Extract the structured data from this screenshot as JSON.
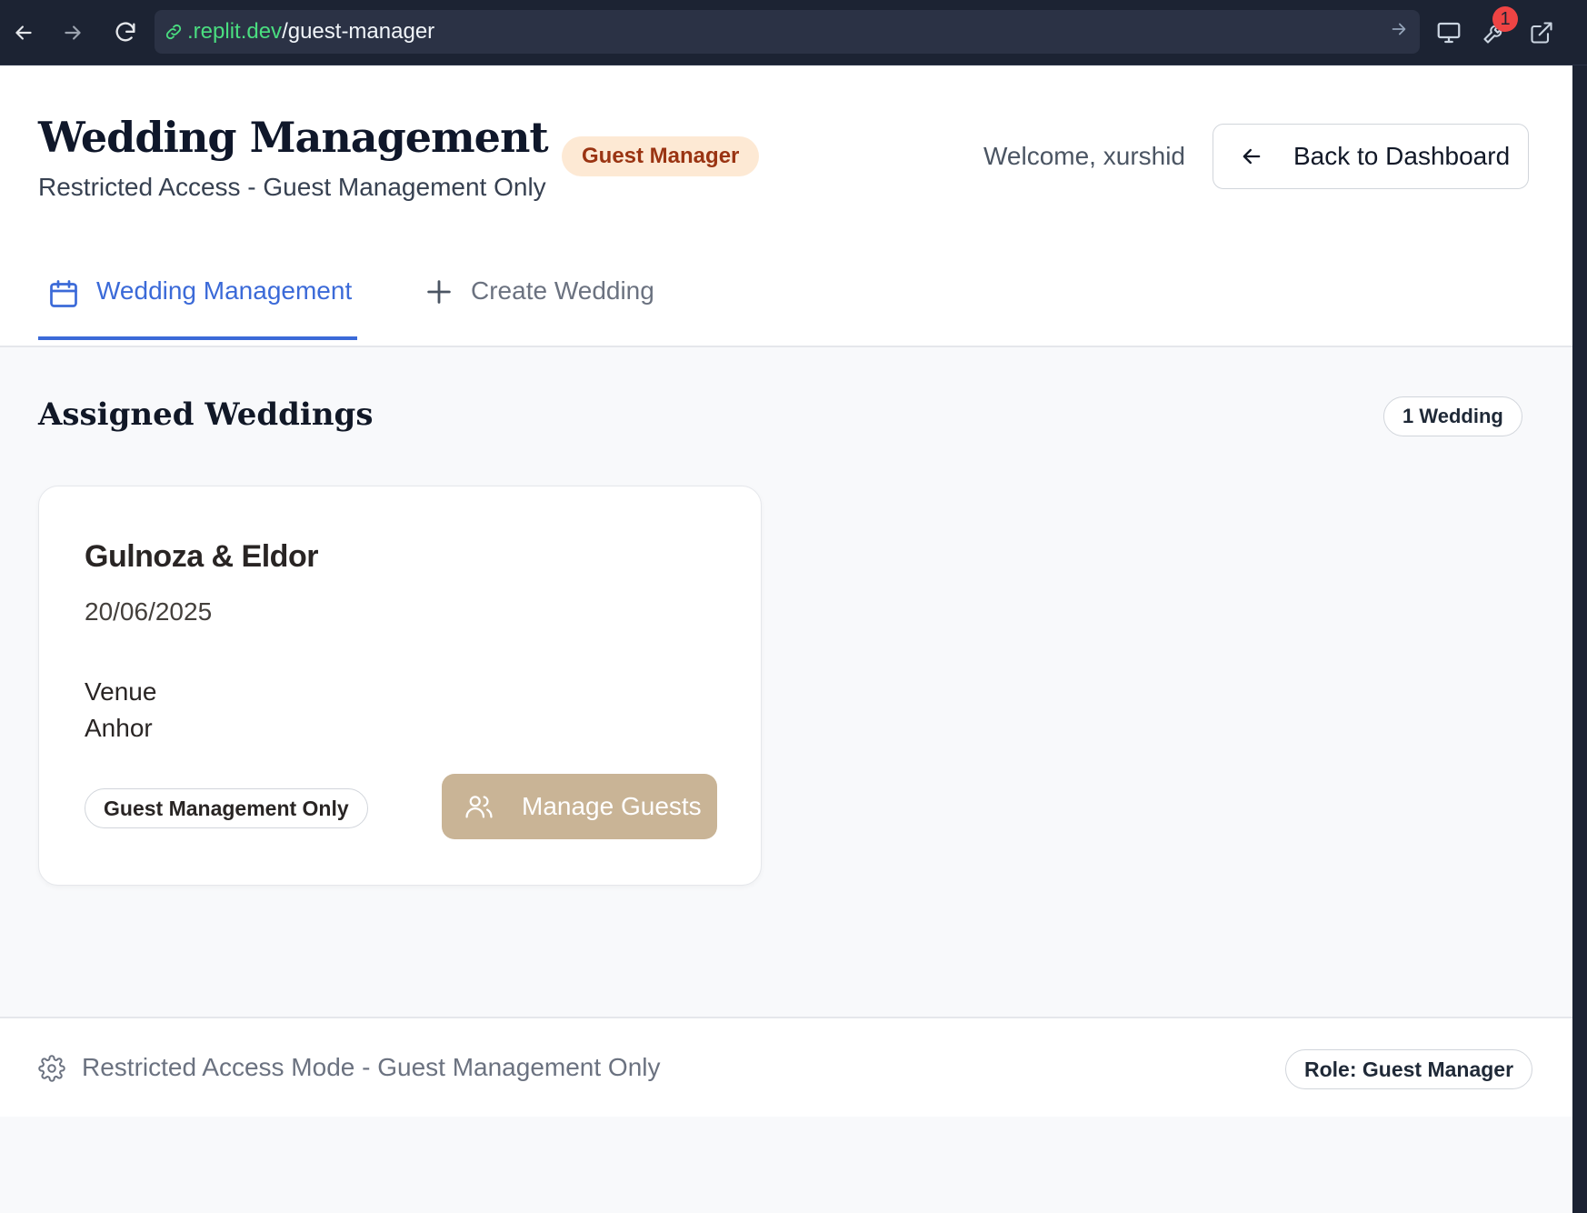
{
  "browser": {
    "url_host": ".replit.dev",
    "url_path": "/guest-manager",
    "notification_count": "1"
  },
  "header": {
    "title": "Wedding Management",
    "subtitle": "Restricted Access - Guest Management Only",
    "role_badge": "Guest Manager",
    "welcome": "Welcome, xurshid",
    "back_button": "Back to Dashboard"
  },
  "tabs": [
    {
      "label": "Wedding Management",
      "icon": "calendar-icon",
      "active": true
    },
    {
      "label": "Create Wedding",
      "icon": "plus-icon",
      "active": false
    }
  ],
  "main": {
    "section_title": "Assigned Weddings",
    "count_badge": "1 Wedding",
    "weddings": [
      {
        "couple": "Gulnoza & Eldor",
        "date": "20/06/2025",
        "venue_label": "Venue",
        "venue": "Anhor",
        "access_badge": "Guest Management Only",
        "action_label": "Manage Guests"
      }
    ]
  },
  "footer": {
    "text": "Restricted Access Mode - Guest Management Only",
    "role_badge": "Role: Guest Manager"
  },
  "colors": {
    "accent": "#3b6ad8",
    "manage_button": "#c9b496",
    "role_chip_bg": "#fde9d4",
    "role_chip_text": "#9a3412",
    "url_host": "#4ade80"
  }
}
